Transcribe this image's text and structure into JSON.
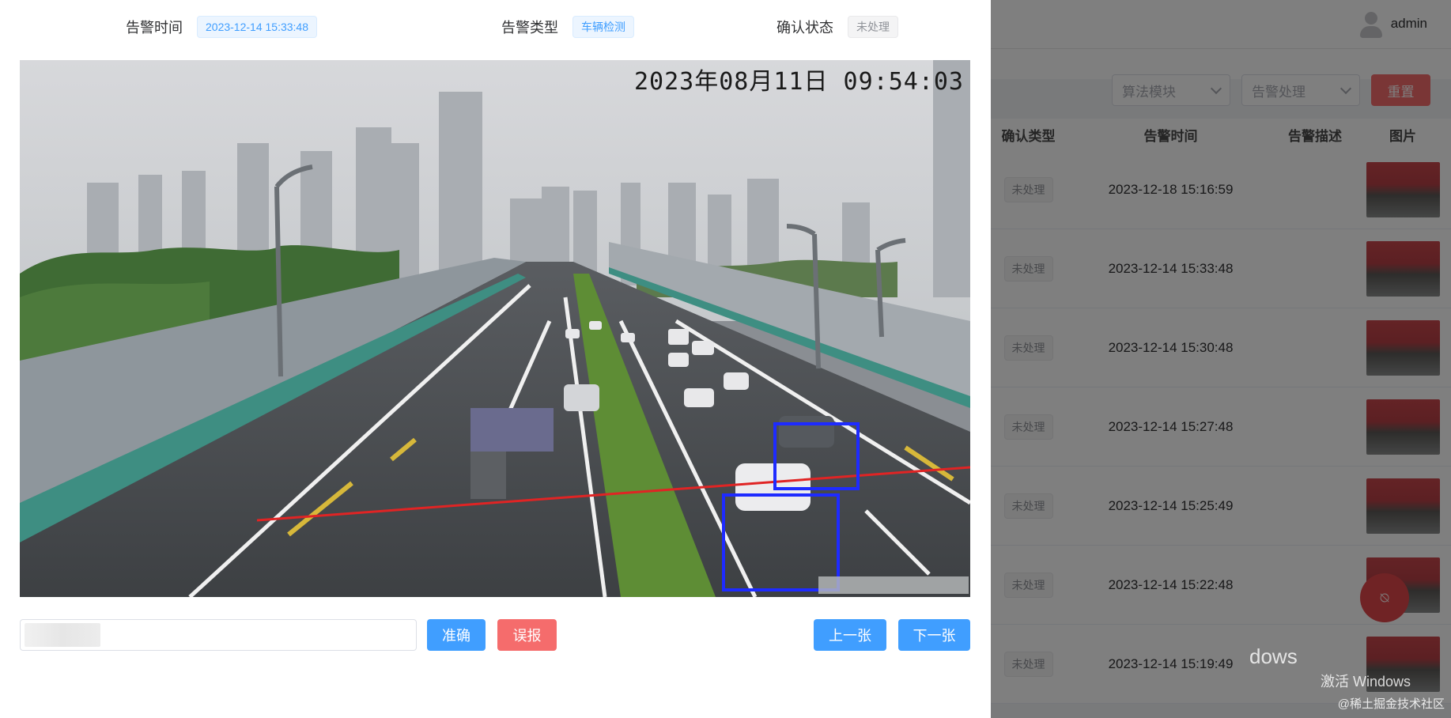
{
  "dialog": {
    "info": {
      "alarm_time_label": "告警时间",
      "alarm_time_value": "2023-12-14 15:33:48",
      "alarm_type_label": "告警类型",
      "alarm_type_value": "车辆检测",
      "confirm_status_label": "确认状态",
      "confirm_status_value": "未处理"
    },
    "image": {
      "camera_timestamp": "2023年08月11日 09:54:03"
    },
    "actions": {
      "remark_value": "",
      "accurate_label": "准确",
      "false_alarm_label": "误报",
      "prev_label": "上一张",
      "next_label": "下一张"
    }
  },
  "background": {
    "user": {
      "name": "admin"
    },
    "filters": {
      "algorithm_placeholder": "算法模块",
      "alarm_handling_placeholder": "告警处理",
      "reset_label": "重置"
    },
    "table": {
      "headers": [
        "确认类型",
        "告警时间",
        "告警描述",
        "图片"
      ],
      "rows": [
        {
          "status": "未处理",
          "time": "2023-12-18 15:16:59"
        },
        {
          "status": "未处理",
          "time": "2023-12-14 15:33:48"
        },
        {
          "status": "未处理",
          "time": "2023-12-14 15:30:48"
        },
        {
          "status": "未处理",
          "time": "2023-12-14 15:27:48"
        },
        {
          "status": "未处理",
          "time": "2023-12-14 15:25:49"
        },
        {
          "status": "未处理",
          "time": "2023-12-14 15:22:48"
        },
        {
          "status": "未处理",
          "time": "2023-12-14 15:19:49"
        }
      ]
    },
    "watermark": {
      "line1": "dows",
      "line2": "激活 Windows"
    },
    "credit": "@稀土掘金技术社区"
  },
  "colors": {
    "primary": "#409eff",
    "danger": "#f56c6c",
    "detection_box": "#1e2bff",
    "tripwire": "#e02424"
  }
}
